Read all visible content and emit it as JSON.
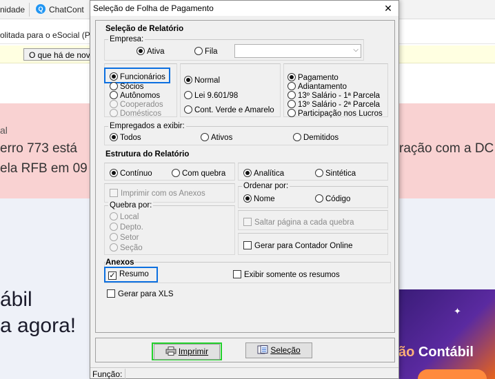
{
  "background": {
    "tab1": "nidade",
    "chat_tab": "ChatCont",
    "tab2": "olitada para o eSocial (Pro",
    "whats_new": "O que há de novo",
    "alert_small": "al",
    "alert_line1": "erro 773 está",
    "alert_line2": "ela RFB em 09",
    "alert_right": "ração com a DC",
    "hero_line1": "ábil",
    "hero_line2": "a agora!",
    "promo_text_a": "ão ",
    "promo_text_b": "Contábil"
  },
  "dialog": {
    "title": "Seleção de Folha de Pagamento",
    "close": "✕",
    "section_report": "Seleção de Relatório",
    "empresa_label": "Empresa:",
    "empresa_options": {
      "ativa": "Ativa",
      "fila": "Fila"
    },
    "empresa_selected": "Ativa",
    "combo_value": "",
    "tipo_options": {
      "funcionarios": "Funcionários",
      "socios": "Sócios",
      "autonomos": "Autônomos",
      "cooperados": "Cooperados",
      "domesticos": "Domésticos"
    },
    "tipo_selected": "Funcionários",
    "lei_options": {
      "normal": "Normal",
      "lei": "Lei 9.601/98",
      "cont_verde": "Cont. Verde e Amarelo"
    },
    "lei_selected": "Normal",
    "pagamento_options": {
      "pagamento": "Pagamento",
      "adiantamento": "Adiantamento",
      "decimo1": "13º Salário  -  1ª Parcela",
      "decimo2": "13º Salário  -  2ª Parcela",
      "participacao": "Participação nos Lucros"
    },
    "pagamento_selected": "Pagamento",
    "empregados_label": "Empregados a exibir:",
    "empregados_options": {
      "todos": "Todos",
      "ativos": "Ativos",
      "demitidos": "Demitidos"
    },
    "empregados_selected": "Todos",
    "section_structure": "Estrutura do Relatório",
    "continuo": "Contínuo",
    "com_quebra": "Com quebra",
    "layout_selected": "Contínuo",
    "imprimir_anexos": "Imprimir com os Anexos",
    "quebra_label": "Quebra por:",
    "quebra_options": {
      "local": "Local",
      "depto": "Depto.",
      "setor": "Setor",
      "secao": "Seção"
    },
    "analitica": "Analítica",
    "sintetica": "Sintética",
    "tipo_relatorio_selected": "Analítica",
    "ordenar_label": "Ordenar por:",
    "ordenar_options": {
      "nome": "Nome",
      "codigo": "Código"
    },
    "ordenar_selected": "Nome",
    "saltar_pagina": "Saltar página a cada quebra",
    "gerar_contador": "Gerar para Contador Online",
    "section_anexos": "Anexos",
    "resumo": "Resumo",
    "resumo_checked": true,
    "exibir_resumos": "Exibir somente os resumos",
    "gerar_xls": "Gerar para XLS",
    "btn_imprimir": "Imprimir",
    "btn_selecao": "Seleção",
    "status_label": "Função:",
    "status_value": ""
  },
  "colors": {
    "highlight_blue": "#0b6fe0",
    "highlight_green": "#22d12b",
    "alert_bg": "#f9d2d2",
    "dialog_bg": "#f0f0f0"
  }
}
